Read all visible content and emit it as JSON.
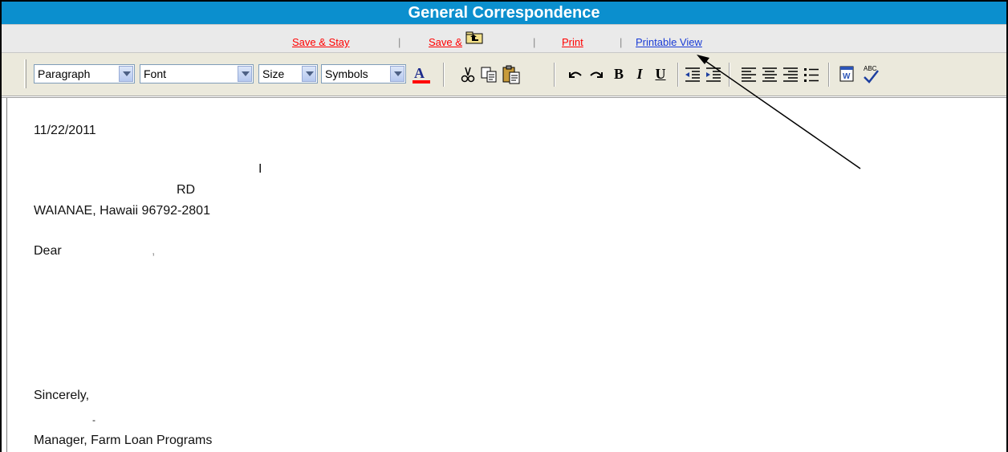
{
  "window": {
    "title": "General Correspondence"
  },
  "actions": {
    "save_stay": "Save & Stay",
    "save_close": "Save &",
    "print": "Print",
    "printable_view": "Printable View",
    "separator": "|"
  },
  "toolbar": {
    "paragraph": "Paragraph",
    "font": "Font",
    "size": "Size",
    "symbols": "Symbols",
    "bold": "B",
    "italic": "I",
    "underline": "U",
    "icons": [
      "font-color-icon",
      "cut-icon",
      "copy-icon",
      "paste-icon",
      "undo-icon",
      "redo-icon",
      "bold-icon",
      "italic-icon",
      "underline-icon",
      "outdent-icon",
      "indent-icon",
      "align-left-icon",
      "align-center-icon",
      "align-right-icon",
      "bullet-list-icon",
      "word-paste-icon",
      "spellcheck-icon"
    ]
  },
  "document": {
    "date": "11/22/2011",
    "name_mark": "I",
    "street": "RD",
    "city_line": "WAIANAE, Hawaii 96792-2801",
    "greeting": "Dear",
    "greeting_comma": ",",
    "closing": "Sincerely,",
    "signature_mark": "-",
    "signer_title": "Manager, Farm Loan Programs"
  },
  "colors": {
    "title_bar": "#0b8fce",
    "action_red": "#ff0000",
    "action_blue": "#1a3cd6",
    "toolbar_bg": "#ebe9dc"
  }
}
